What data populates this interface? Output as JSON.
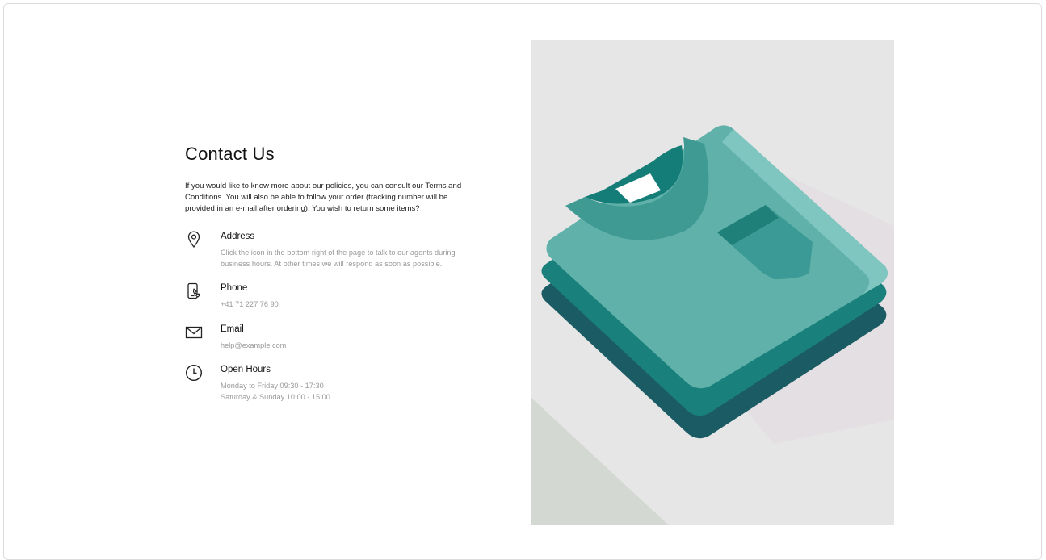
{
  "contact": {
    "title": "Contact Us",
    "intro": "If you would like to know more about our policies, you can consult our Terms and Conditions. You will also be able to follow your order (tracking number will be provided in an e-mail after ordering). You wish to return some items?",
    "items": [
      {
        "icon": "map-pin-icon",
        "label": "Address",
        "text": "Click the icon in the bottom right of the page to talk to our agents during business hours. At other times we will respond as soon as possible."
      },
      {
        "icon": "phone-icon",
        "label": "Phone",
        "text": "+41 71 227 76 90"
      },
      {
        "icon": "email-icon",
        "label": "Email",
        "text": "help@example.com"
      },
      {
        "icon": "clock-icon",
        "label": "Open Hours",
        "line1": "Monday to Friday 09:30 - 17:30",
        "line2": "Saturday & Sunday 10:00 - 15:00"
      }
    ]
  },
  "colors": {
    "background": "#e6e6e6",
    "shirt_light": "#5fb1aa",
    "shirt_mid": "#1a807c",
    "shirt_dark": "#1b5b63",
    "collar": "#157d77"
  }
}
